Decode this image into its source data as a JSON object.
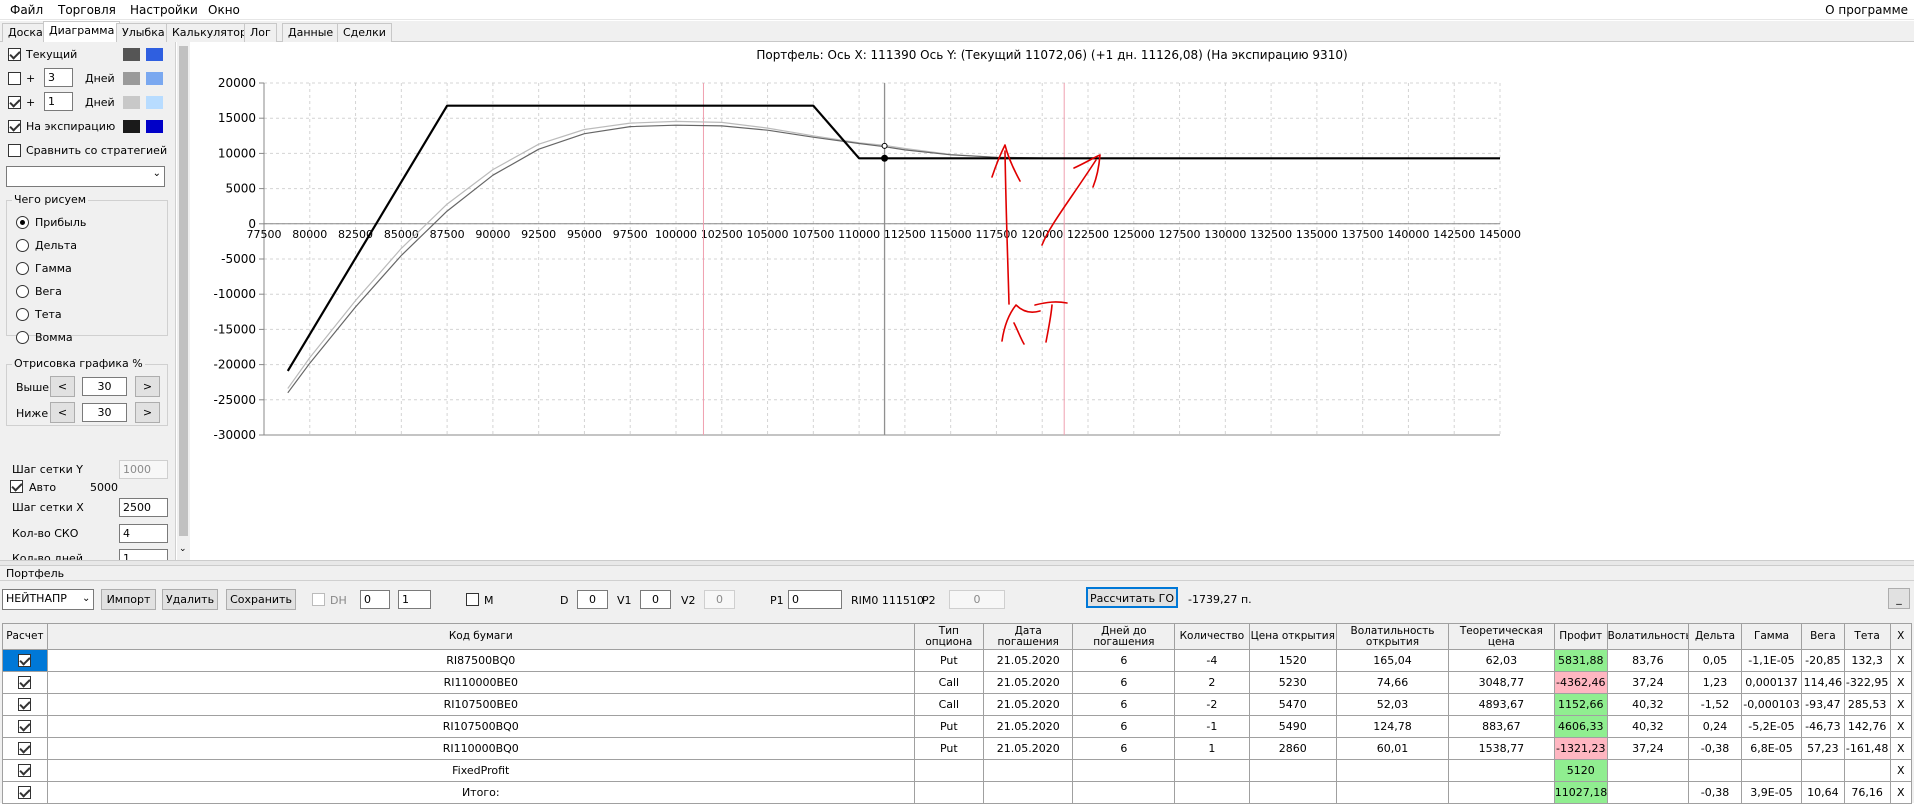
{
  "menu": {
    "items": [
      "Файл",
      "Торговля",
      "Настройки",
      "Окно"
    ],
    "about": "О программе"
  },
  "tabs": [
    "Доска",
    "Диаграмма",
    "Улыбка",
    "Калькулятор",
    "Лог",
    "Данные",
    "Сделки"
  ],
  "left_panel": {
    "current_label": "Текущий",
    "plus1": "+",
    "days1_value": "3",
    "days1_label": "Дней",
    "plus2": "+",
    "days2_value": "1",
    "days2_label": "Дней",
    "expiry_label": "На экспирацию",
    "compare_label": "Сравнить со стратегией",
    "draw_group": "Чего рисуем",
    "options": [
      "Прибыль",
      "Дельта",
      "Гамма",
      "Вега",
      "Тета",
      "Вомма"
    ],
    "render_group": "Отрисовка графика %",
    "above_label": "Выше",
    "above_value": "30",
    "below_label": "Ниже",
    "below_value": "30",
    "dec": "<",
    "inc": ">",
    "grid_y_label": "Шаг сетки Y",
    "grid_y_value": "1000",
    "auto_label": "Авто",
    "auto_value": "5000",
    "grid_x_label": "Шаг сетки X",
    "grid_x_value": "2500",
    "sko_label": "Кол-во СКО",
    "sko_value": "4",
    "days_count_label": "Кол-во дней",
    "days_count_value": "1",
    "swatch_colors": [
      "#555555",
      "#2f5fe0",
      "#9a9a9a",
      "#7aa8f0",
      "#c8c8c8",
      "#b8dcff",
      "#1a1a1a",
      "#0000c8"
    ]
  },
  "chart_data": {
    "type": "line",
    "title": "Портфель: Ось X: 111390 Ось Y: (Текущий 11072,06) (+1 дн. 11126,08) (На экспирацию 9310)",
    "xlim": [
      77500,
      145000
    ],
    "ylim": [
      -30000,
      20000
    ],
    "x_ticks": [
      "77500",
      "80000",
      "82500",
      "85000",
      "87500",
      "90000",
      "92500",
      "95000",
      "97500",
      "100000",
      "102500",
      "105000",
      "107500",
      "110000",
      "112500",
      "115000",
      "117500",
      "120000",
      "122500",
      "125000",
      "127500",
      "130000",
      "132500",
      "135000",
      "137500",
      "140000",
      "142500",
      "145000"
    ],
    "y_ticks": [
      "20000",
      "15000",
      "10000",
      "5000",
      "0",
      "-5000",
      "-10000",
      "-15000",
      "-20000",
      "-25000",
      "-30000"
    ],
    "cursor_x": 111390,
    "vertical_markers": [
      101500,
      121200
    ],
    "series": [
      {
        "name": "На экспирацию",
        "color": "#000000",
        "width": 2.2,
        "points": [
          [
            78800,
            -20900
          ],
          [
            87500,
            16770
          ],
          [
            107500,
            16770
          ],
          [
            110000,
            9310
          ],
          [
            145000,
            9310
          ]
        ]
      },
      {
        "name": "Текущий",
        "color": "#666666",
        "width": 1.2,
        "points": [
          [
            78800,
            -24000
          ],
          [
            80000,
            -19800
          ],
          [
            82500,
            -11800
          ],
          [
            85000,
            -4500
          ],
          [
            87500,
            1800
          ],
          [
            90000,
            6900
          ],
          [
            92500,
            10600
          ],
          [
            95000,
            12800
          ],
          [
            97500,
            13800
          ],
          [
            100000,
            14000
          ],
          [
            102500,
            13900
          ],
          [
            105000,
            13300
          ],
          [
            107500,
            12300
          ],
          [
            110000,
            11400
          ],
          [
            111390,
            10950
          ],
          [
            112500,
            10500
          ],
          [
            115000,
            9800
          ],
          [
            117500,
            9450
          ],
          [
            120000,
            9330
          ],
          [
            122500,
            9310
          ],
          [
            145000,
            9310
          ]
        ]
      },
      {
        "name": "+1 дн.",
        "color": "#bbbbbb",
        "width": 1.2,
        "points": [
          [
            78800,
            -23400
          ],
          [
            80000,
            -19000
          ],
          [
            82500,
            -10900
          ],
          [
            85000,
            -3500
          ],
          [
            87500,
            2800
          ],
          [
            90000,
            7700
          ],
          [
            92500,
            11300
          ],
          [
            95000,
            13400
          ],
          [
            97500,
            14300
          ],
          [
            100000,
            14550
          ],
          [
            102500,
            14400
          ],
          [
            105000,
            13600
          ],
          [
            107500,
            12500
          ],
          [
            110000,
            11500
          ],
          [
            111390,
            11130
          ],
          [
            112500,
            10700
          ],
          [
            115000,
            9850
          ],
          [
            117500,
            9450
          ],
          [
            120000,
            9330
          ],
          [
            122500,
            9310
          ],
          [
            145000,
            9310
          ]
        ]
      }
    ],
    "markers": [
      {
        "x": 111390,
        "y": 11072
      },
      {
        "x": 111390,
        "y": 9310
      }
    ]
  },
  "portfolio": {
    "title": "Портфель",
    "account": "НЕЙТНАПР",
    "import": "Импорт",
    "delete": "Удалить",
    "save": "Сохранить",
    "dh_label": "DH",
    "dh1": "0",
    "dh2": "1",
    "m_label": "M",
    "d_label": "D",
    "d_value": "0",
    "v1_label": "V1",
    "v1_value": "0",
    "v2_label": "V2",
    "v2_value": "0",
    "p1_label": "P1",
    "p1_value": "0",
    "rim_text": "RIM0 111510",
    "p2_label": "P2",
    "p2_value": "0",
    "calc_go": "Рассчитать ГО",
    "go_value": "-1739,27 п.",
    "minimize": "_",
    "columns": [
      "Расчет",
      "Код бумаги",
      "Тип опциона",
      "Дата погашения",
      "Дней до погашения",
      "Количество",
      "Цена открытия",
      "Волатильность открытия",
      "Теоретическая цена",
      "Профит",
      "Волатильность",
      "Дельта",
      "Гамма",
      "Вега",
      "Тета",
      "X"
    ],
    "rows": [
      {
        "code": "RI87500BQ0",
        "type": "Put",
        "date": "21.05.2020",
        "days": "6",
        "qty": "-4",
        "open": "1520",
        "vol_open": "165,04",
        "theo": "62,03",
        "profit": "5831,88",
        "profit_state": "green",
        "vol": "83,76",
        "delta": "0,05",
        "gamma": "-1,1E-05",
        "vega": "-20,85",
        "theta": "132,3",
        "x": "X"
      },
      {
        "code": "RI110000BE0",
        "type": "Call",
        "date": "21.05.2020",
        "days": "6",
        "qty": "2",
        "open": "5230",
        "vol_open": "74,66",
        "theo": "3048,77",
        "profit": "-4362,46",
        "profit_state": "red",
        "vol": "37,24",
        "delta": "1,23",
        "gamma": "0,000137",
        "vega": "114,46",
        "theta": "-322,95",
        "x": "X"
      },
      {
        "code": "RI107500BE0",
        "type": "Call",
        "date": "21.05.2020",
        "days": "6",
        "qty": "-2",
        "open": "5470",
        "vol_open": "52,03",
        "theo": "4893,67",
        "profit": "1152,66",
        "profit_state": "green",
        "vol": "40,32",
        "delta": "-1,52",
        "gamma": "-0,000103",
        "vega": "-93,47",
        "theta": "285,53",
        "x": "X"
      },
      {
        "code": "RI107500BQ0",
        "type": "Put",
        "date": "21.05.2020",
        "days": "6",
        "qty": "-1",
        "open": "5490",
        "vol_open": "124,78",
        "theo": "883,67",
        "profit": "4606,33",
        "profit_state": "green",
        "vol": "40,32",
        "delta": "0,24",
        "gamma": "-5,2E-05",
        "vega": "-46,73",
        "theta": "142,76",
        "x": "X"
      },
      {
        "code": "RI110000BQ0",
        "type": "Put",
        "date": "21.05.2020",
        "days": "6",
        "qty": "1",
        "open": "2860",
        "vol_open": "60,01",
        "theo": "1538,77",
        "profit": "-1321,23",
        "profit_state": "red",
        "vol": "37,24",
        "delta": "-0,38",
        "gamma": "6,8E-05",
        "vega": "57,23",
        "theta": "-161,48",
        "x": "X"
      },
      {
        "code": "FixedProfit",
        "type": "",
        "date": "",
        "days": "",
        "qty": "",
        "open": "",
        "vol_open": "",
        "theo": "",
        "profit": "5120",
        "profit_state": "green",
        "vol": "",
        "delta": "",
        "gamma": "",
        "vega": "",
        "theta": "",
        "x": "X"
      },
      {
        "code": "Итого:",
        "type": "",
        "date": "",
        "days": "",
        "qty": "",
        "open": "",
        "vol_open": "",
        "theo": "",
        "profit": "11027,18",
        "profit_state": "green",
        "vol": "",
        "delta": "-0,38",
        "gamma": "3,9E-05",
        "vega": "10,64",
        "theta": "76,16",
        "x": "X"
      }
    ]
  }
}
